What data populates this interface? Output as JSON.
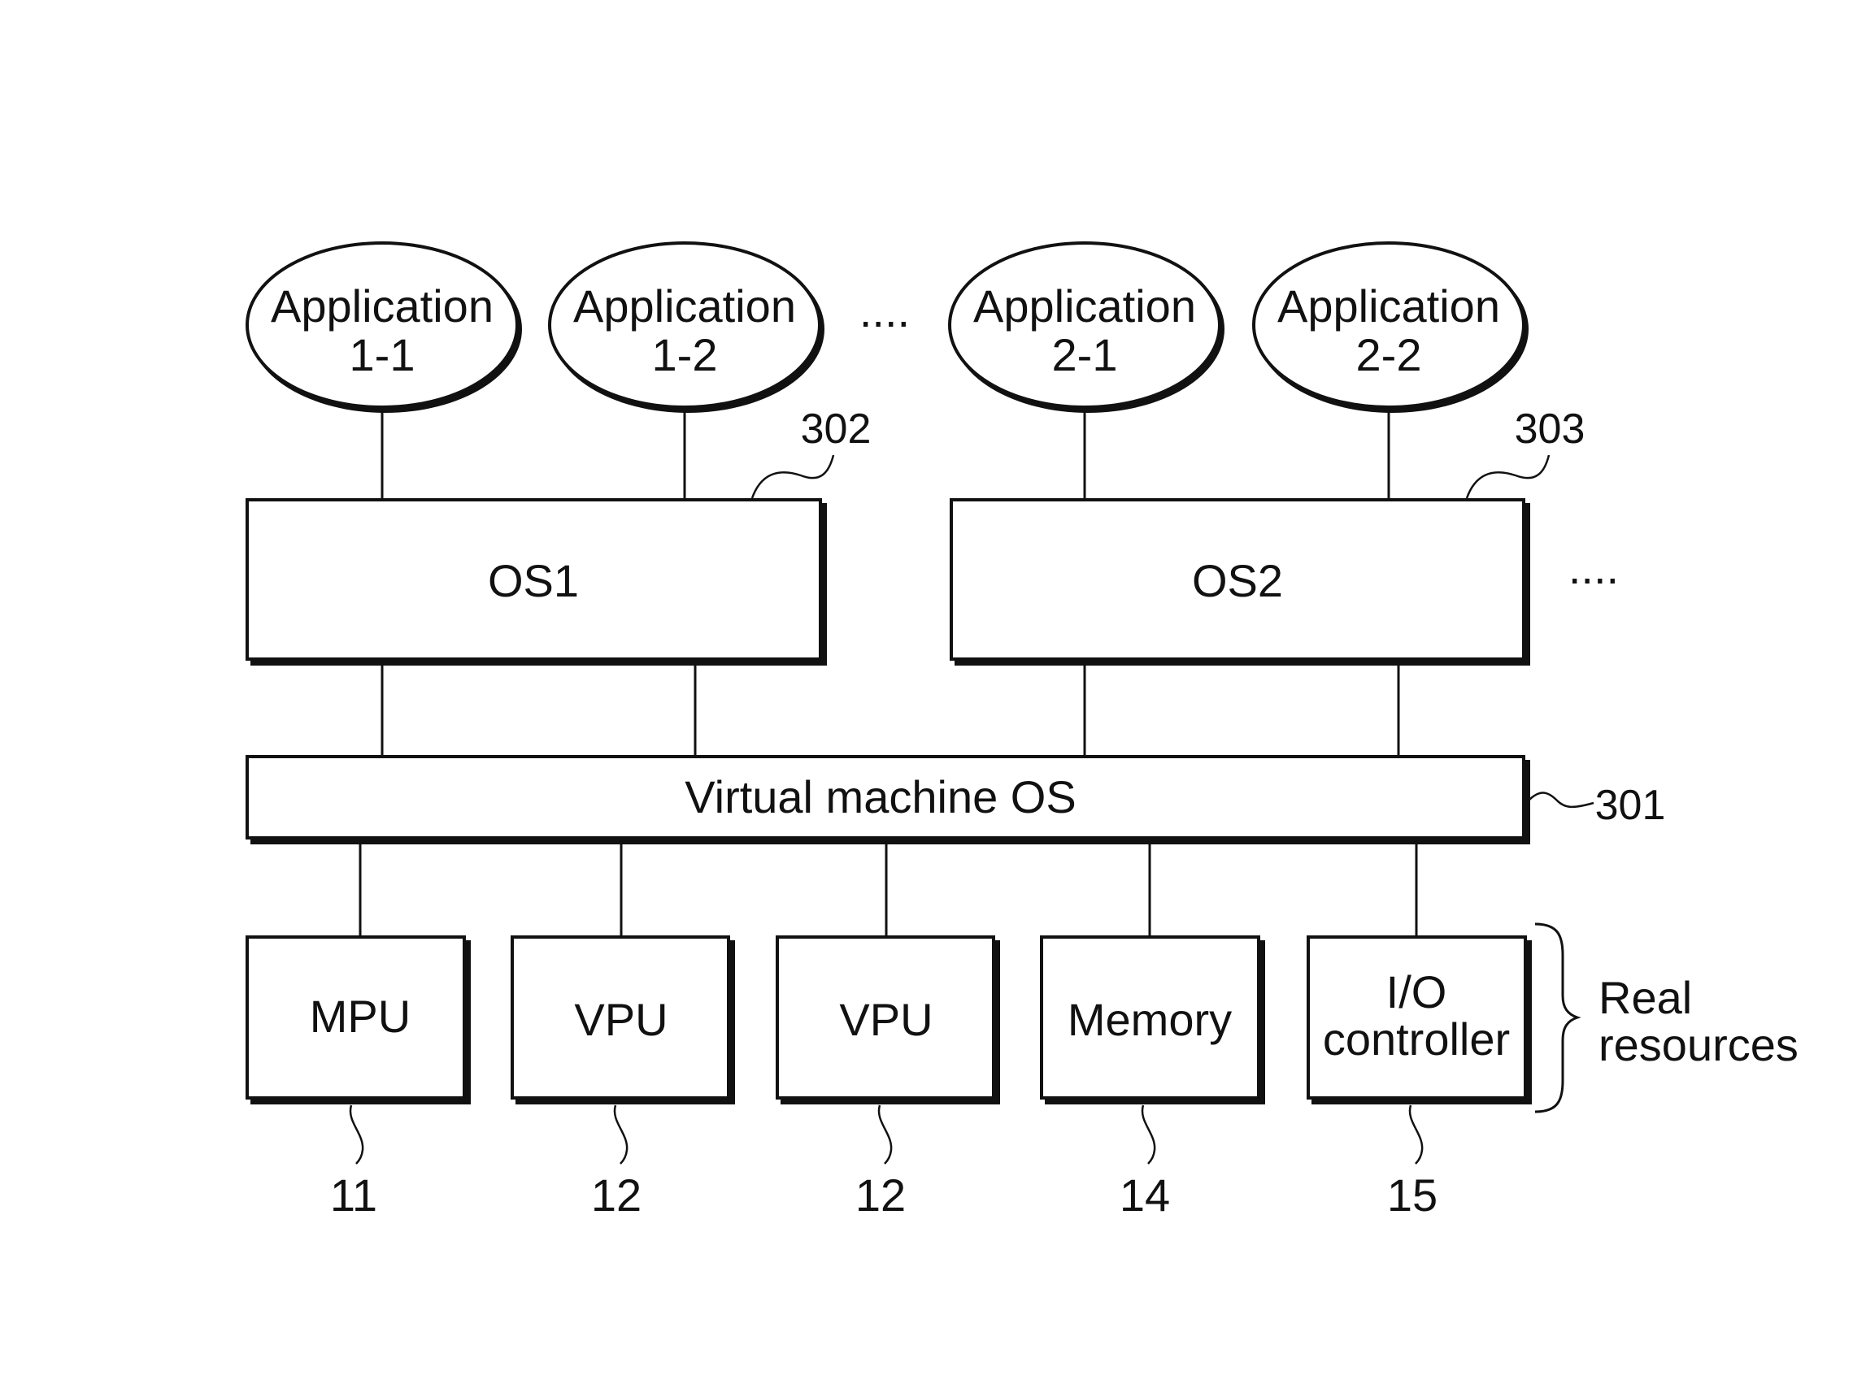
{
  "applications": [
    {
      "line1": "Application",
      "line2": "1-1"
    },
    {
      "line1": "Application",
      "line2": "1-2"
    },
    {
      "line1": "Application",
      "line2": "2-1"
    },
    {
      "line1": "Application",
      "line2": "2-2"
    }
  ],
  "ellipsis_apps": "....",
  "ellipsis_os": "....",
  "os_boxes": [
    {
      "label": "OS1",
      "ref": "302"
    },
    {
      "label": "OS2",
      "ref": "303"
    }
  ],
  "vm_os": {
    "label": "Virtual  machine  OS",
    "ref": "301"
  },
  "resources": [
    {
      "label1": "MPU",
      "label2": "",
      "ref": "11"
    },
    {
      "label1": "VPU",
      "label2": "",
      "ref": "12"
    },
    {
      "label1": "VPU",
      "label2": "",
      "ref": "12"
    },
    {
      "label1": "Memory",
      "label2": "",
      "ref": "14"
    },
    {
      "label1": "I/O",
      "label2": "controller",
      "ref": "15"
    }
  ],
  "real_resources": {
    "line1": "Real",
    "line2": "resources"
  }
}
